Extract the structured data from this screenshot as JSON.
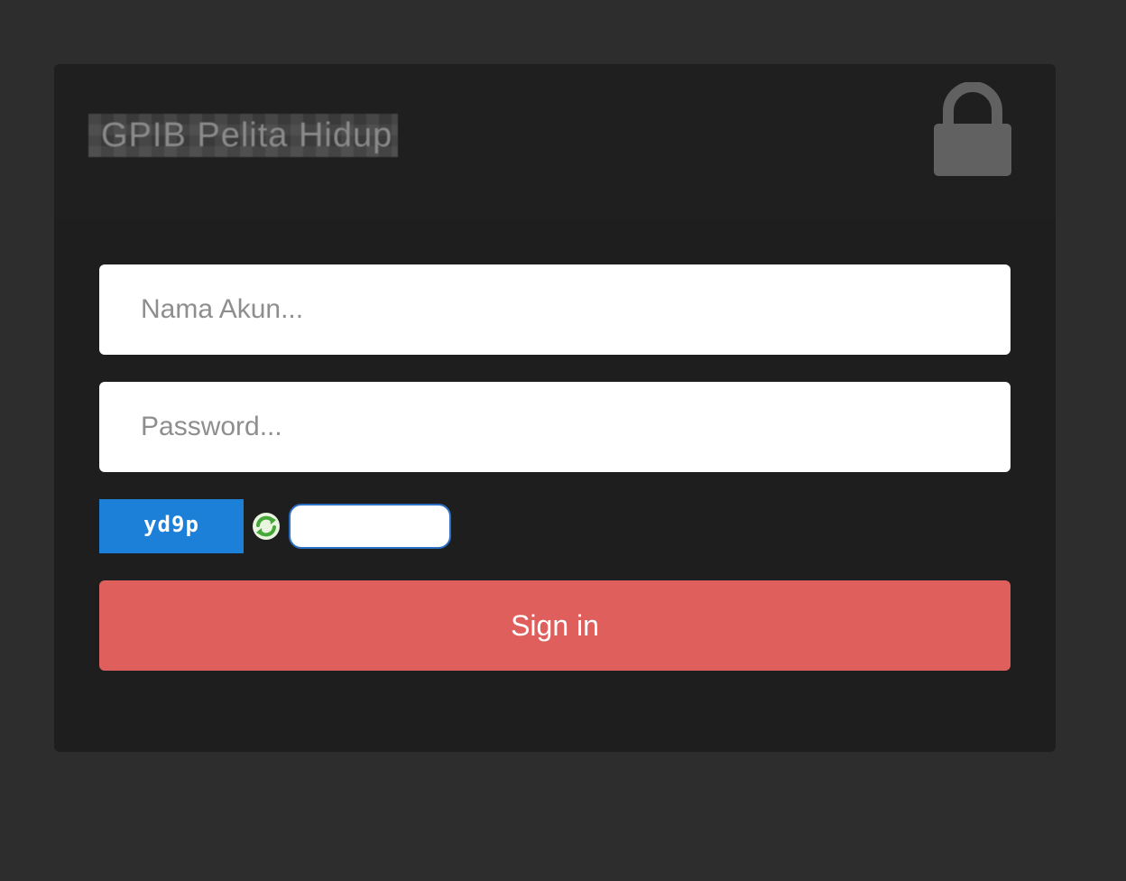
{
  "header": {
    "site_title": "GPIB Pelita Hidup",
    "lock_icon": "lock-icon"
  },
  "form": {
    "username_placeholder": "Nama Akun...",
    "password_placeholder": "Password...",
    "captcha_text": "yd9p",
    "refresh_icon": "refresh-icon",
    "captcha_value": "",
    "signin_label": "Sign in"
  },
  "colors": {
    "page_background": "#2d2d2d",
    "card_background": "#1e1e1e",
    "captcha_background": "#1c7fd8",
    "signin_button": "#df5f5c",
    "lock_icon": "#616161"
  }
}
